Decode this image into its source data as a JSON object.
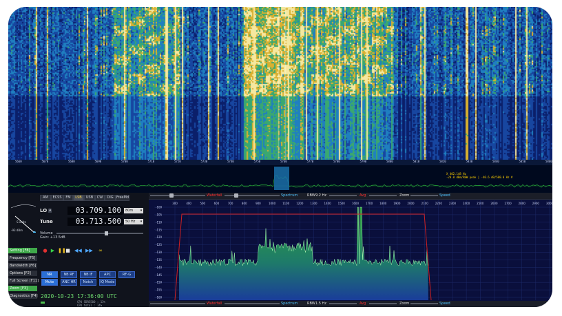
{
  "waterfall_axis": [
    "5660",
    "5670",
    "5680",
    "5690",
    "5700",
    "5710",
    "5720",
    "5730",
    "5740",
    "5750",
    "5760",
    "5770",
    "5780",
    "5790",
    "5800",
    "5810",
    "5820",
    "5830",
    "5840",
    "5850",
    "5860"
  ],
  "strip": {
    "note_line1": "X 402.148 Hz",
    "note_line2": "-28.8 dBm/RBW peak | -40.6 dB/500.0 Hz #"
  },
  "modes": [
    "AM",
    "ECSS",
    "FM",
    "LSB",
    "USB",
    "CW",
    "DIG",
    "FreeMd"
  ],
  "active_mode": "LSB",
  "lo": {
    "label": "LO",
    "badge": "A",
    "value": "03.709.100",
    "unit": "80m"
  },
  "tune": {
    "label": "Tune",
    "value": "03.713.500",
    "unit": "50 Hz"
  },
  "volume_label": "Volume",
  "gain_label": "Gain: +13.5dB",
  "dial_label": "S-units",
  "dial_value": "-93 dBm",
  "side_buttons": [
    {
      "label": "Setting  [F8]",
      "green": true
    },
    {
      "label": "Frequency [F5]",
      "green": false
    },
    {
      "label": "Bandwidth  [F6]",
      "green": false
    },
    {
      "label": "Options  [F2]",
      "green": false
    },
    {
      "label": "Full Screen [F11]",
      "green": false
    },
    {
      "label": "Zoom  [F3]",
      "green": true
    },
    {
      "label": "Diagnostics  [F4]",
      "green": false
    }
  ],
  "ctl_row1": [
    "NR",
    "NB RF",
    "NB IF",
    "APC",
    "RF-G"
  ],
  "ctl_row2": [
    "Mute",
    "ANC HR",
    "Notch",
    "IQ Mode"
  ],
  "clock": "2020-10-23  17:36:00 UTC",
  "cpu_line1": "CPU SDR5500 : 13%",
  "cpu_line2": "CPU total : 14%",
  "top_bar": {
    "waterfall": "Waterfall",
    "spectrum": "Spectrum",
    "rbw_label": "RBW",
    "rbw_value": "9.2 Hz",
    "avg": "Avg",
    "zoom": "Zoom",
    "speed": "Speed"
  },
  "bottom_bar": {
    "waterfall": "Waterfall",
    "spectrum": "Spectrum",
    "rbw_label": "RBW",
    "rbw_value": "1.5 Hz",
    "avg": "Avg",
    "zoom": "Zoom",
    "speed": "Speed"
  },
  "spectrum_x_ticks": [
    "300",
    "400",
    "500",
    "600",
    "700",
    "800",
    "900",
    "1000",
    "1100",
    "1200",
    "1300",
    "1400",
    "1500",
    "1600",
    "1700",
    "1800",
    "1900",
    "2000",
    "2100",
    "2200",
    "2300",
    "2400",
    "2500",
    "2600",
    "2700",
    "2800",
    "2900",
    "3000"
  ],
  "spectrum_y_ticks": [
    "-100",
    "-105",
    "-110",
    "-115",
    "-120",
    "-125",
    "-130",
    "-135",
    "-140",
    "-145",
    "-150",
    "-155",
    "-160"
  ],
  "colors": {
    "waterfall_bg": "#0a1a5a",
    "accent_red": "#ff2a2a",
    "cyan": "#4fc3ff",
    "spectrum_green": "#36b34a",
    "passband_line": "#d22020"
  }
}
